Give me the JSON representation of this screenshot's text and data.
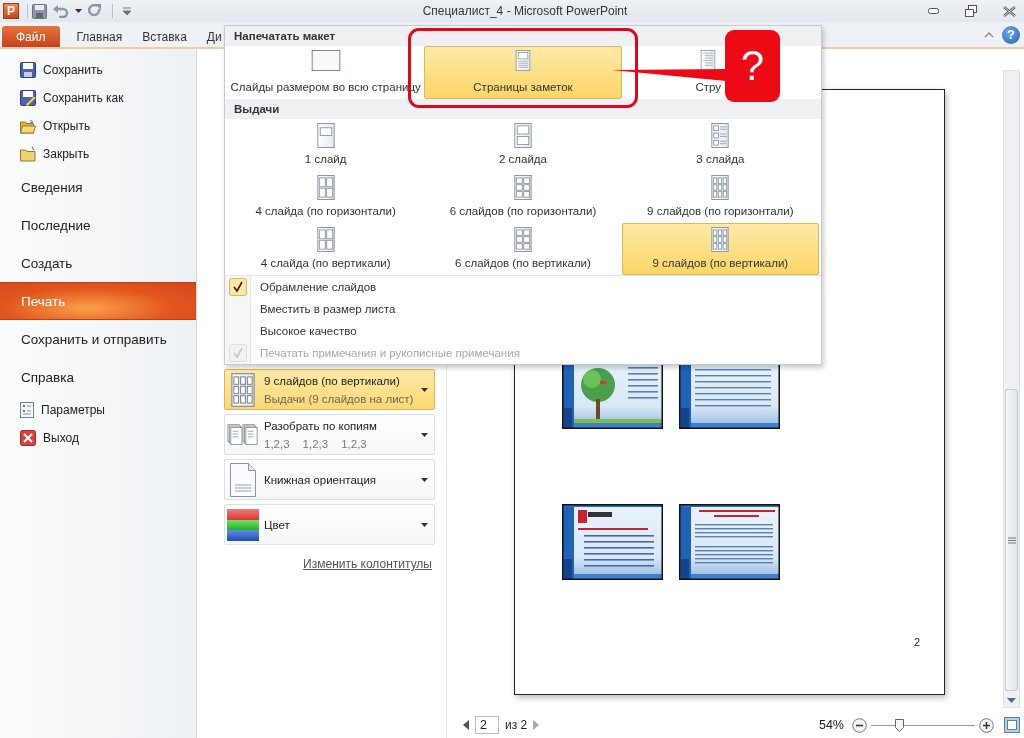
{
  "window": {
    "title": "Специалист_4 - Microsoft PowerPoint",
    "app_logo": "P"
  },
  "ribbon_tabs": [
    {
      "label": "Файл",
      "selected": true
    },
    {
      "label": "Главная",
      "selected": false
    },
    {
      "label": "Вставка",
      "selected": false
    },
    {
      "label": "Ди",
      "selected": false
    }
  ],
  "ribbon": {
    "help": "?"
  },
  "sidebar": {
    "items": [
      {
        "label": "Сохранить",
        "kind": "save",
        "selected": false
      },
      {
        "label": "Сохранить как",
        "kind": "save_as",
        "selected": false
      },
      {
        "label": "Открыть",
        "kind": "open",
        "selected": false
      },
      {
        "label": "Закрыть",
        "kind": "close",
        "selected": false
      },
      {
        "label": "Сведения",
        "kind": "page",
        "selected": false
      },
      {
        "label": "Последние",
        "kind": "page",
        "selected": false
      },
      {
        "label": "Создать",
        "kind": "page",
        "selected": false
      },
      {
        "label": "Печать",
        "kind": "page",
        "selected": true
      },
      {
        "label": "Сохранить и отправить",
        "kind": "page",
        "selected": false
      },
      {
        "label": "Справка",
        "kind": "page",
        "selected": false
      },
      {
        "label": "Параметры",
        "kind": "options",
        "selected": false
      },
      {
        "label": "Выход",
        "kind": "exit",
        "selected": false
      }
    ]
  },
  "settings": {
    "dropdowns": [
      {
        "kind": "layout",
        "title": "9 слайдов (по вертикали)",
        "subtitle": "Выдачи (9 слайдов на лист)",
        "selected": true
      },
      {
        "kind": "collate",
        "title": "Разобрать по копиям",
        "sequence": [
          "1,2,3",
          "1,2,3",
          "1,2,3"
        ],
        "selected": false
      },
      {
        "kind": "orientation",
        "title": "Книжная ориентация",
        "selected": false
      },
      {
        "kind": "color",
        "title": "Цвет",
        "selected": false
      }
    ],
    "link": "Изменить колонтитулы"
  },
  "preview": {
    "page_number": "2"
  },
  "status_bar": {
    "page_input": "2",
    "page_total": "из 2",
    "zoom": "54%",
    "zoom_slider": {
      "level": 0.27
    }
  },
  "layout_menu": {
    "print_layout_title": "Напечатать макет",
    "print_layouts": [
      {
        "label": "Слайды размером во всю страницу",
        "selected": false
      },
      {
        "label": "Страницы заметок",
        "selected": true
      },
      {
        "label": "Стру",
        "selected": false
      }
    ],
    "handouts_title": "Выдачи",
    "handouts": [
      {
        "label": "1 слайд",
        "selected": false
      },
      {
        "label": "2 слайда",
        "selected": false
      },
      {
        "label": "3 слайда",
        "selected": false
      },
      {
        "label": "4 слайда (по горизонтали)",
        "selected": false
      },
      {
        "label": "6 слайдов (по горизонтали)",
        "selected": false
      },
      {
        "label": "9 слайдов (по горизонтали)",
        "selected": false
      },
      {
        "label": "4 слайда (по вертикали)",
        "selected": false
      },
      {
        "label": "6 слайдов (по вертикали)",
        "selected": false
      },
      {
        "label": "9 слайдов (по вертикали)",
        "selected": true
      }
    ],
    "options": [
      {
        "label": "Обрамление слайдов",
        "checked": true,
        "disabled": false
      },
      {
        "label": "Вместить в размер листа",
        "checked": false,
        "disabled": false
      },
      {
        "label": "Высокое качество",
        "checked": false,
        "disabled": false
      },
      {
        "label": "Печатать примечания и рукописные примечания",
        "checked": true,
        "disabled": true
      }
    ]
  },
  "annotation": {
    "mark": "?"
  }
}
